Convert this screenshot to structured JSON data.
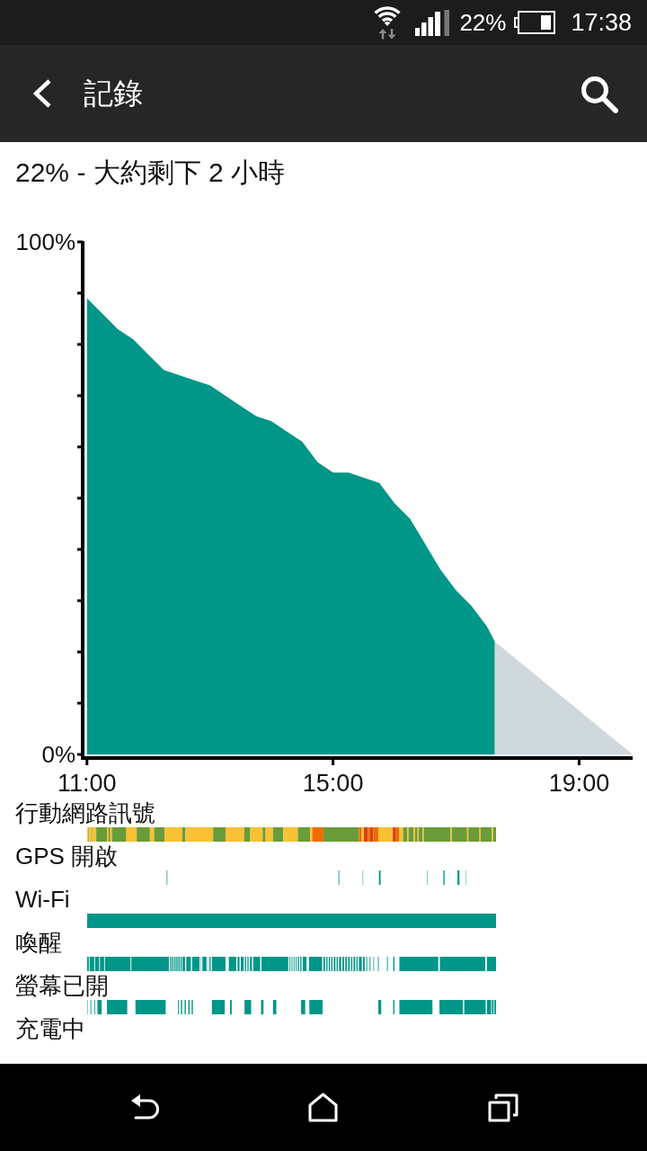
{
  "status_bar": {
    "battery": "22%",
    "time": "17:38"
  },
  "app_bar": {
    "title": "記錄"
  },
  "summary": "22% - 大約剩下 2 小時",
  "chart": {
    "chart_data": {
      "type": "area",
      "x": [
        11,
        11.25,
        11.5,
        11.75,
        12,
        12.25,
        12.5,
        12.75,
        13,
        13.25,
        13.5,
        13.75,
        14,
        14.25,
        14.5,
        14.75,
        15,
        15.25,
        15.5,
        15.75,
        16,
        16.25,
        16.5,
        16.75,
        17,
        17.25,
        17.5,
        17.63,
        19.87
      ],
      "series": [
        {
          "color": "#009688",
          "values": [
            89,
            86,
            83,
            81,
            78,
            75,
            74,
            73,
            72,
            70,
            68,
            66,
            65,
            63,
            61,
            57,
            55,
            55,
            54,
            53,
            49,
            46,
            41,
            36,
            32,
            29,
            25,
            22,
            null
          ]
        },
        {
          "color": "#cfd8dc",
          "values": [
            null,
            null,
            null,
            null,
            null,
            null,
            null,
            null,
            null,
            null,
            null,
            null,
            null,
            null,
            null,
            null,
            null,
            null,
            null,
            null,
            null,
            null,
            null,
            null,
            null,
            null,
            null,
            22,
            0
          ]
        }
      ],
      "xlim": [
        10.93,
        19.87
      ],
      "ylim": [
        0,
        100
      ],
      "xticks": [
        {
          "value": 11,
          "label": "11:00"
        },
        {
          "value": 15,
          "label": "15:00"
        },
        {
          "value": 19,
          "label": "19:00"
        }
      ],
      "yticks": [
        {
          "value": 0,
          "label": "0%"
        },
        {
          "value": 100,
          "label": "100%"
        }
      ]
    }
  },
  "timelines": [
    {
      "label": "行動網路訊號",
      "kind": "colors"
    },
    {
      "label": "GPS 開啟",
      "kind": "ticks"
    },
    {
      "label": "Wi-Fi",
      "kind": "solid"
    },
    {
      "label": "喚醒",
      "kind": "stripes"
    },
    {
      "label": "螢幕已開",
      "kind": "blocks"
    },
    {
      "label": "充電中",
      "kind": "blank"
    }
  ]
}
